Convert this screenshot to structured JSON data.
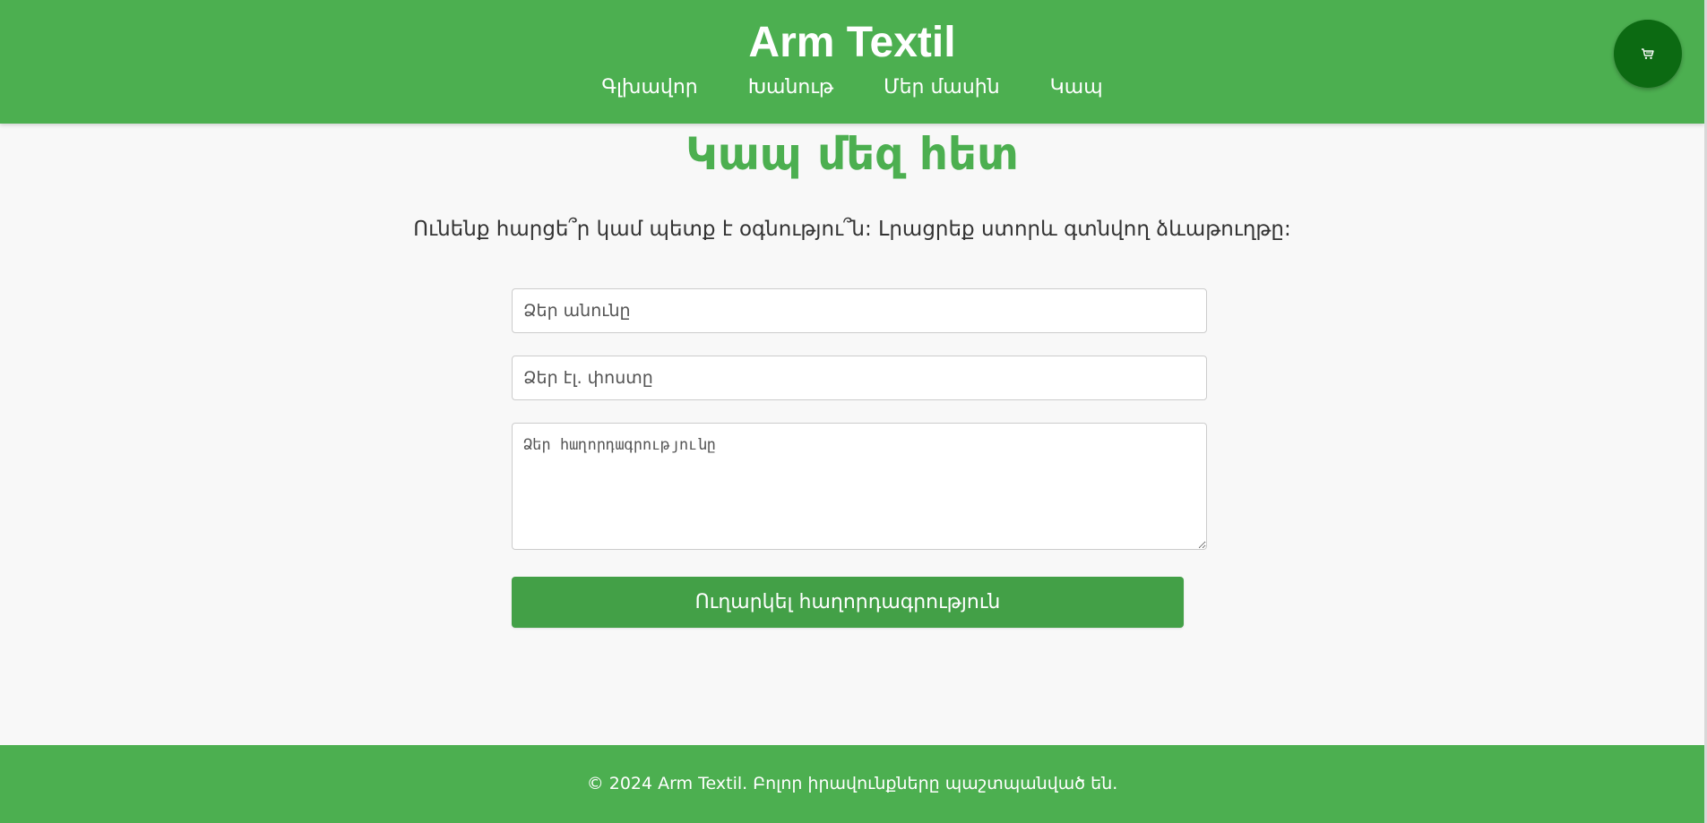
{
  "header": {
    "title": "Arm Textil",
    "nav": [
      {
        "label": "Գլխավոր"
      },
      {
        "label": "Խանութ"
      },
      {
        "label": "Մեր մասին"
      },
      {
        "label": "Կապ"
      }
    ],
    "cart_icon": "cart-icon"
  },
  "contact": {
    "title": "Կապ մեզ հետ",
    "intro": "Ունենք հարցե՞ր կամ պետք է օգնությու՞ն: Լրացրեք ստորև գտնվող ձևաթուղթը:",
    "name_placeholder": "Ձեր անունը",
    "email_placeholder": "Ձեր էլ. փոստը",
    "message_placeholder": "Ձեր հաղորդագրությունը",
    "submit_label": "Ուղարկել հաղորդագրություն"
  },
  "footer": {
    "text": "© 2024 Arm Textil. Բոլոր իրավունքները պաշտպանված են."
  },
  "colors": {
    "brand": "#4caf50",
    "button": "#43a047",
    "cart_button": "#0c6a12",
    "background": "#f8f8f8"
  }
}
